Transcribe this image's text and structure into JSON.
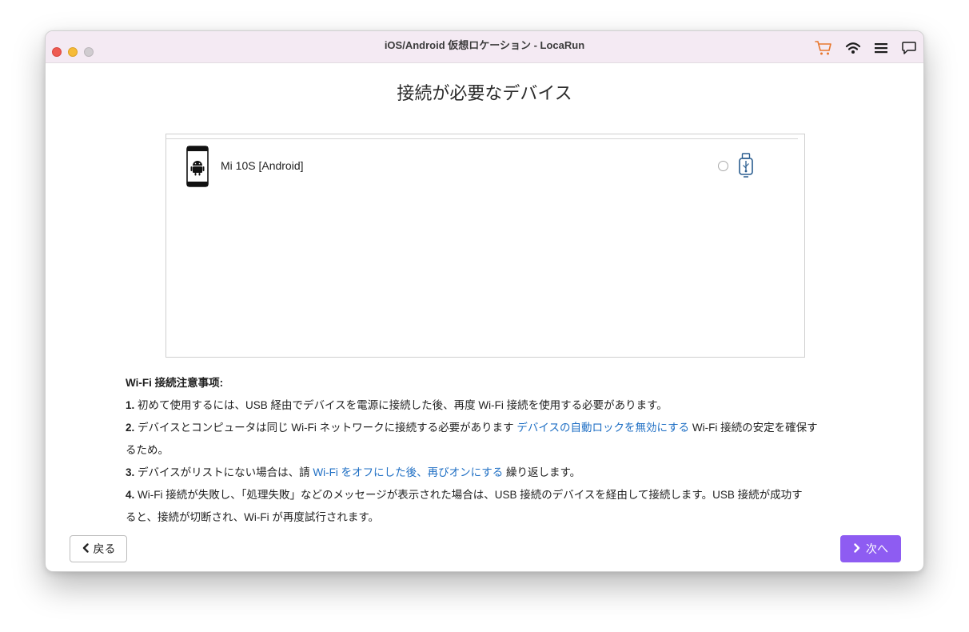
{
  "window": {
    "title": "iOS/Android 仮想ロケーション - LocaRun"
  },
  "toolbar_icons": [
    "cart-icon",
    "wifi-icon",
    "menu-icon",
    "feedback-icon"
  ],
  "colors": {
    "accent": "#8e5cf2",
    "link": "#1f6fc4",
    "cart": "#e8772e",
    "titlebar_bg": "#f4eaf3"
  },
  "main": {
    "heading": "接続が必要なデバイス",
    "devices": [
      {
        "name": "Mi 10S [Android]",
        "icon": "android-phone-icon",
        "connection_icon": "usb-icon",
        "selected": false
      }
    ]
  },
  "notes": {
    "title": "Wi-Fi 接続注意事项:",
    "item1_num": "1.",
    "item1_text": " 初めて使用するには、USB 経由でデバイスを電源に接続した後、再度 Wi-Fi 接続を使用する必要があります。",
    "item2_num": "2.",
    "item2_text_a": " デバイスとコンピュータは同じ Wi-Fi ネットワークに接続する必要があります ",
    "item2_link": "デバイスの自動ロックを無効にする",
    "item2_text_b": " Wi-Fi 接続の安定を確保す",
    "item2_text_c": "るため。",
    "item3_num": "3.",
    "item3_text_a": " デバイスがリストにない場合は、請 ",
    "item3_link": "Wi-Fi をオフにした後、再びオンにする",
    "item3_text_b": " 繰り返します。",
    "item4_num": "4.",
    "item4_text_a": " Wi-Fi 接続が失敗し、「処理失敗」などのメッセージが表示された場合は、USB 接続のデバイスを経由して接続します。USB 接続が成功す",
    "item4_text_b": "ると、接続が切断され、Wi-Fi が再度試行されます。"
  },
  "footer": {
    "back_label": "戻る",
    "next_label": "次へ"
  }
}
